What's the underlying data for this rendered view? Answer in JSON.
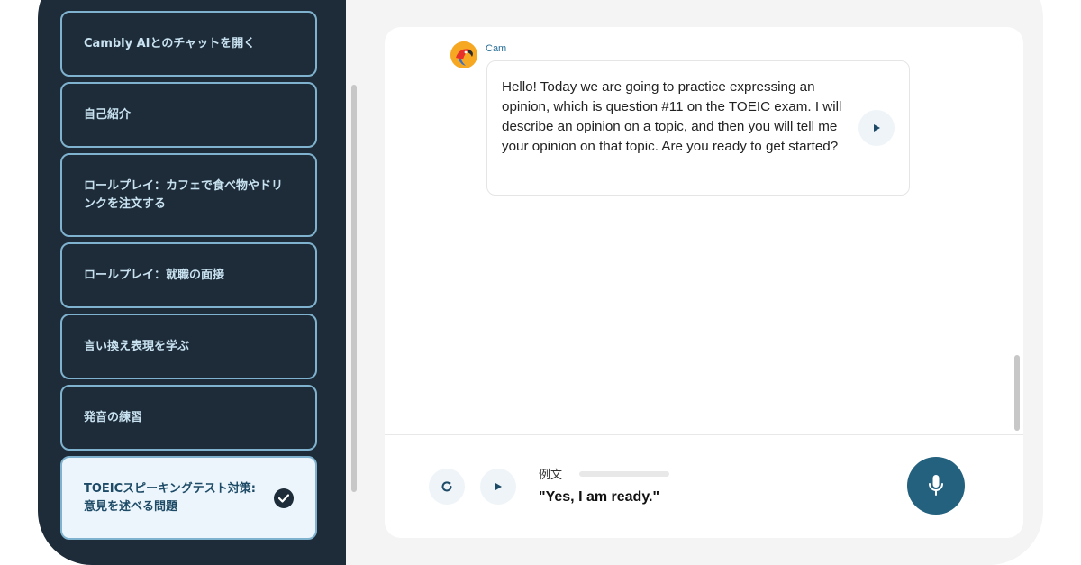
{
  "sidebar": {
    "items": [
      {
        "label": "Cambly AIとのチャットを開く"
      },
      {
        "label": "自己紹介"
      },
      {
        "label": "ロールプレイ：カフェで食べ物やドリンクを注文する"
      },
      {
        "label": "ロールプレイ：就職の面接"
      },
      {
        "label": "言い換え表現を学ぶ"
      },
      {
        "label": "発音の練習"
      },
      {
        "label": "TOEICスピーキングテスト対策: 意見を述べる問題",
        "active": true
      }
    ]
  },
  "chat": {
    "sender": "Cam",
    "message": "Hello! Today we are going to practice expressing an opinion, which is question #11 on the TOEIC exam. I will describe an opinion on a topic, and then you will tell me your opinion on that topic. Are you ready to get started?"
  },
  "footer": {
    "example_label": "例文",
    "example_text": "\"Yes, I am ready.\""
  },
  "colors": {
    "sidebar_bg": "#1d2c38",
    "accent": "#23617e",
    "card_border": "#7fb2cf"
  },
  "icons": [
    "checkmark-icon",
    "play-icon",
    "refresh-icon",
    "microphone-icon",
    "parrot-avatar"
  ]
}
